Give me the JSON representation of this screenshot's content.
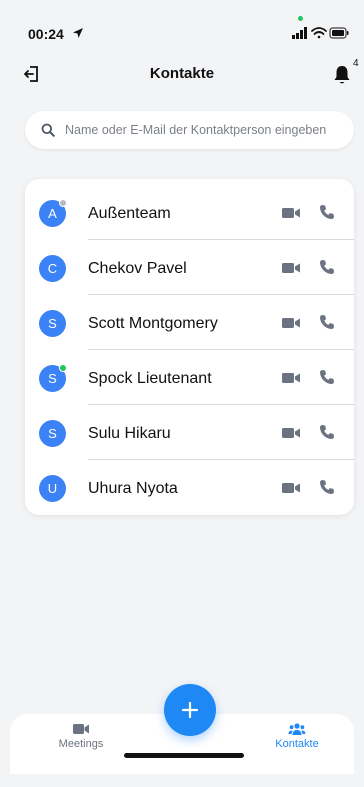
{
  "status_bar": {
    "time": "00:24",
    "location_icon": "location-arrow-icon",
    "icons": [
      "signal-icon",
      "wifi-icon",
      "battery-icon"
    ]
  },
  "header": {
    "title": "Kontakte",
    "logout_icon": "logout-icon",
    "bell_icon": "bell-icon",
    "notification_count": "4"
  },
  "search": {
    "placeholder": "Name oder E-Mail der Kontaktperson eingeben"
  },
  "contacts": [
    {
      "initial": "A",
      "name": "Außenteam",
      "presence": "away"
    },
    {
      "initial": "C",
      "name": "Chekov Pavel",
      "presence": "none"
    },
    {
      "initial": "S",
      "name": "Scott Montgomery",
      "presence": "none"
    },
    {
      "initial": "S",
      "name": "Spock Lieutenant",
      "presence": "online"
    },
    {
      "initial": "S",
      "name": "Sulu Hikaru",
      "presence": "none"
    },
    {
      "initial": "U",
      "name": "Uhura Nyota",
      "presence": "none"
    }
  ],
  "tabbar": {
    "meetings_label": "Meetings",
    "contacts_label": "Kontakte",
    "add_icon": "plus-icon"
  },
  "colors": {
    "accent": "#1e88f5",
    "avatar": "#3b82f6",
    "online": "#22c55e",
    "away": "#b5bcc6",
    "icon": "#6b7280"
  }
}
